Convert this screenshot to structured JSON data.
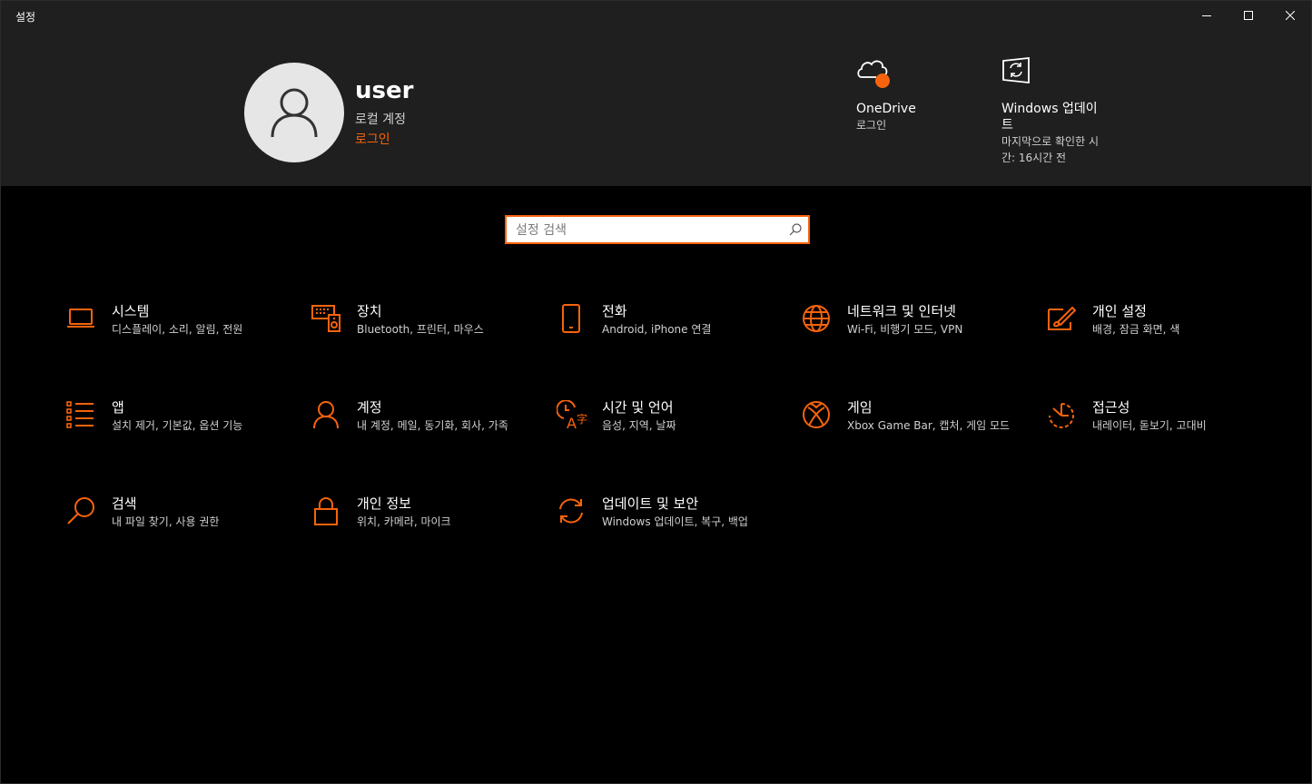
{
  "window": {
    "title": "설정",
    "accent": "#f7630c"
  },
  "user": {
    "name": "user",
    "account_type": "로컬 계정",
    "signin_link": "로그인"
  },
  "header_tiles": [
    {
      "icon": "onedrive-cloud-icon",
      "title": "OneDrive",
      "subtitle": "로그인"
    },
    {
      "icon": "windows-update-icon",
      "title": "Windows 업데이트",
      "subtitle": "마지막으로 확인한 시간: 16시간 전"
    }
  ],
  "search": {
    "placeholder": "설정 검색"
  },
  "categories": [
    {
      "icon": "laptop-icon",
      "title": "시스템",
      "subtitle": "디스플레이, 소리, 알림, 전원"
    },
    {
      "icon": "keyboard-speaker-icon",
      "title": "장치",
      "subtitle": "Bluetooth, 프린터, 마우스"
    },
    {
      "icon": "phone-icon",
      "title": "전화",
      "subtitle": "Android, iPhone 연결"
    },
    {
      "icon": "globe-icon",
      "title": "네트워크 및 인터넷",
      "subtitle": "Wi-Fi, 비행기 모드, VPN"
    },
    {
      "icon": "paint-brush-icon",
      "title": "개인 설정",
      "subtitle": "배경, 잠금 화면, 색"
    },
    {
      "icon": "apps-list-icon",
      "title": "앱",
      "subtitle": "설치 제거, 기본값, 옵션 기능"
    },
    {
      "icon": "person-icon",
      "title": "계정",
      "subtitle": "내 계정, 메일, 동기화, 회사, 가족"
    },
    {
      "icon": "time-language-icon",
      "title": "시간 및 언어",
      "subtitle": "음성, 지역, 날짜"
    },
    {
      "icon": "xbox-icon",
      "title": "게임",
      "subtitle": "Xbox Game Bar, 캡처, 게임 모드"
    },
    {
      "icon": "accessibility-timer-icon",
      "title": "접근성",
      "subtitle": "내레이터, 돋보기, 고대비"
    },
    {
      "icon": "search-icon",
      "title": "검색",
      "subtitle": "내 파일 찾기, 사용 권한"
    },
    {
      "icon": "lock-icon",
      "title": "개인 정보",
      "subtitle": "위치, 카메라, 마이크"
    },
    {
      "icon": "update-arrows-icon",
      "title": "업데이트 및 보안",
      "subtitle": "Windows 업데이트, 복구, 백업"
    }
  ]
}
